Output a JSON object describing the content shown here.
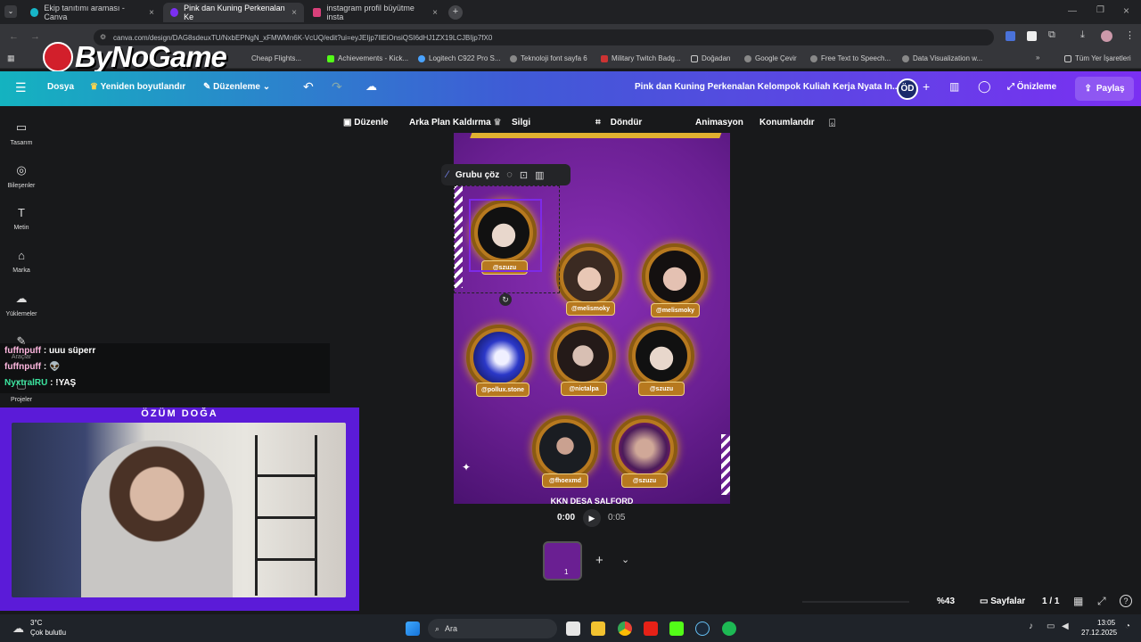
{
  "browser": {
    "tabs": [
      {
        "label": "Ekip tanıtımı araması - Canva",
        "active": false
      },
      {
        "label": "Pink dan Kuning Perkenalan Ke",
        "active": true
      },
      {
        "label": "instagram profil büyütme insta",
        "active": false
      }
    ],
    "url": "canva.com/design/DAG8sdeuxTU/NxbEPNgN_xFMWMn6K-VcUQ/edit?ui=eyJEIjp7IlEiOnsiQSI6dHJ1ZX19LCJBIjp7fX0",
    "bookmarks": [
      "Cheap Flights...",
      "Achievements - Kick...",
      "Logitech C922 Pro S...",
      "Teknoloji font sayfa 6",
      "Military Twitch Badg...",
      "Doğadan",
      "Google Çevir",
      "Free Text to Speech...",
      "Data Visualization w..."
    ],
    "all_bookmarks": "Tüm Yer İşaretleri",
    "watermark": "ByNoGame"
  },
  "canva_header": {
    "file": "Dosya",
    "resize": "Yeniden boyutlandır",
    "edit": "Düzenleme",
    "title": "Pink dan Kuning Perkenalan Kelompok Kuliah Kerja Nyata In...",
    "avatar": "ÖD",
    "preview": "Önizleme",
    "share": "Paylaş"
  },
  "edit_bar": {
    "edit": "Düzenle",
    "bg_remove": "Arka Plan Kaldırma",
    "eraser": "Silgi",
    "rotate": "Döndür",
    "animation": "Animasyon",
    "position": "Konumlandır",
    "swatch_color": "#b7791f"
  },
  "left_rail": [
    {
      "label": "Tasarım",
      "icon": "layout-icon"
    },
    {
      "label": "Bileşenler",
      "icon": "elements-icon"
    },
    {
      "label": "Metin",
      "icon": "text-icon"
    },
    {
      "label": "Marka",
      "icon": "brand-icon"
    },
    {
      "label": "Yüklemeler",
      "icon": "upload-icon"
    },
    {
      "label": "Araçlar",
      "icon": "tools-icon"
    },
    {
      "label": "Projeler",
      "icon": "folder-icon"
    }
  ],
  "group_toolbar": {
    "ungroup": "Grubu çöz"
  },
  "design": {
    "profiles": [
      "@szuzu",
      "@melismoky",
      "@melismoky",
      "@pollux.stone",
      "@nictalpa",
      "@szuzu",
      "@fhoexmd",
      "@szuzu"
    ],
    "footer_text": "KKN DESA SALFORD"
  },
  "player": {
    "current": "0:00",
    "total": "0:05"
  },
  "page_thumb_number": "1",
  "zoom": "%43",
  "pages_label": "Sayfalar",
  "page_count": "1 / 1",
  "chat": [
    {
      "user": "fuffnpuff",
      "msg": "uuu süperr",
      "color": "#ffb8e0"
    },
    {
      "user": "fuffnpuff",
      "msg": "👽",
      "color": "#ffb8e0"
    },
    {
      "user": "NyxtralRU",
      "msg": "!YAŞ",
      "color": "#3ce6a0"
    }
  ],
  "cam_title": "ÖZÜM DOĞA",
  "taskbar": {
    "weather_temp": "3°C",
    "weather_desc": "Çok bulutlu",
    "search": "Ara",
    "time": "13:05",
    "date": "27.12.2025"
  }
}
